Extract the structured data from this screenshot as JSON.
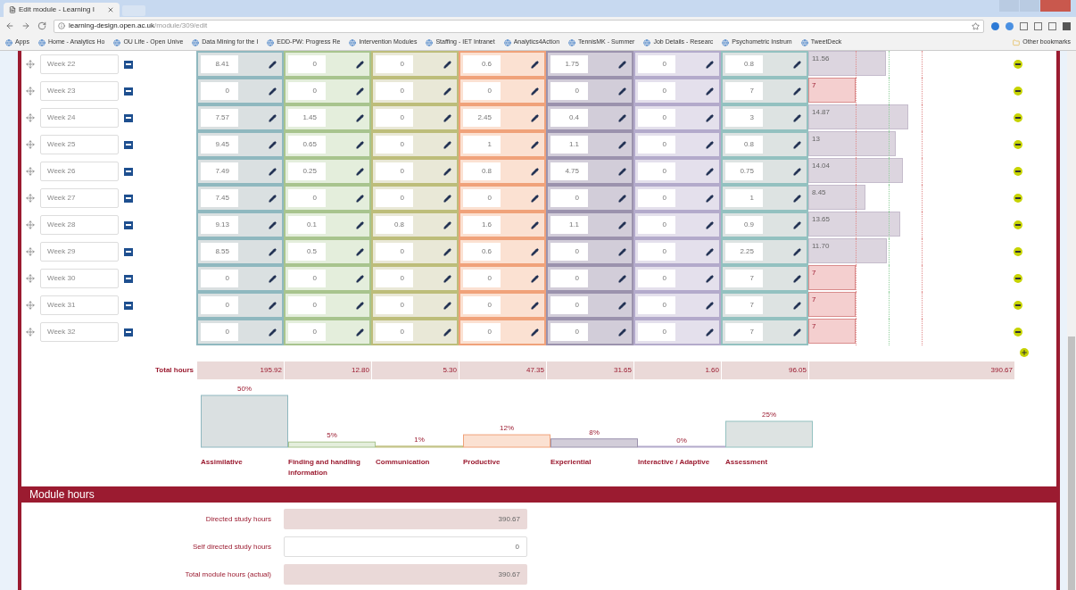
{
  "browser": {
    "tabs": [
      {
        "title": "Edit module - Learning I",
        "selected": true
      }
    ],
    "url_host": "learning-design.open.ac.uk",
    "url_path": "/module/309/edit",
    "bookmarks": [
      "Apps",
      "Home - Analytics Ho",
      "OU Life - Open Unive",
      "Data Mining for the I",
      "EDD-PW: Progress Re",
      "Intervention Modules",
      "Staffing - IET Intranet",
      "Analytics4Action",
      "TennisMK - Summer",
      "Job Details - Researc",
      "Psychometric Instrum",
      "TweetDeck"
    ],
    "other_bookmarks": "Other bookmarks"
  },
  "weeks": [
    {
      "label": "Week 22",
      "values": [
        "8.41",
        "0",
        "0",
        "0.6",
        "1.75",
        "0",
        "0.8"
      ],
      "total": "11.56",
      "flagged": false
    },
    {
      "label": "Week 23",
      "values": [
        "0",
        "0",
        "0",
        "0",
        "0",
        "0",
        "7"
      ],
      "total": "7",
      "flagged": true
    },
    {
      "label": "Week 24",
      "values": [
        "7.57",
        "1.45",
        "0",
        "2.45",
        "0.4",
        "0",
        "3"
      ],
      "total": "14.87",
      "flagged": false
    },
    {
      "label": "Week 25",
      "values": [
        "9.45",
        "0.65",
        "0",
        "1",
        "1.1",
        "0",
        "0.8"
      ],
      "total": "13",
      "flagged": false
    },
    {
      "label": "Week 26",
      "values": [
        "7.49",
        "0.25",
        "0",
        "0.8",
        "4.75",
        "0",
        "0.75"
      ],
      "total": "14.04",
      "flagged": false
    },
    {
      "label": "Week 27",
      "values": [
        "7.45",
        "0",
        "0",
        "0",
        "0",
        "0",
        "1"
      ],
      "total": "8.45",
      "flagged": false
    },
    {
      "label": "Week 28",
      "values": [
        "9.13",
        "0.1",
        "0.8",
        "1.6",
        "1.1",
        "0",
        "0.9"
      ],
      "total": "13.65",
      "flagged": false
    },
    {
      "label": "Week 29",
      "values": [
        "8.55",
        "0.5",
        "0",
        "0.6",
        "0",
        "0",
        "2.25"
      ],
      "total": "11.70",
      "flagged": false
    },
    {
      "label": "Week 30",
      "values": [
        "0",
        "0",
        "0",
        "0",
        "0",
        "0",
        "7"
      ],
      "total": "7",
      "flagged": true
    },
    {
      "label": "Week 31",
      "values": [
        "0",
        "0",
        "0",
        "0",
        "0",
        "0",
        "7"
      ],
      "total": "7",
      "flagged": true
    },
    {
      "label": "Week 32",
      "values": [
        "0",
        "0",
        "0",
        "0",
        "0",
        "0",
        "7"
      ],
      "total": "7",
      "flagged": true
    }
  ],
  "totals": {
    "label": "Total hours",
    "values": [
      "195.92",
      "12.80",
      "5.30",
      "47.35",
      "31.65",
      "1.60",
      "96.05"
    ],
    "grand": "390.67"
  },
  "chart_data": {
    "type": "bar",
    "categories": [
      "Assimilative",
      "Finding and handling information",
      "Communication",
      "Productive",
      "Experiential",
      "Interactive / Adaptive",
      "Assessment"
    ],
    "values": [
      50,
      5,
      1,
      12,
      8,
      0,
      25
    ],
    "value_labels": [
      "50%",
      "5%",
      "1%",
      "12%",
      "8%",
      "0%",
      "25%"
    ]
  },
  "module_hours": {
    "title": "Module hours",
    "fields": [
      {
        "label": "Directed study hours",
        "value": "390.67",
        "readonly": true
      },
      {
        "label": "Self directed study hours",
        "value": "0",
        "readonly": false
      },
      {
        "label": "Total module hours (actual)",
        "value": "390.67",
        "readonly": true
      }
    ]
  }
}
